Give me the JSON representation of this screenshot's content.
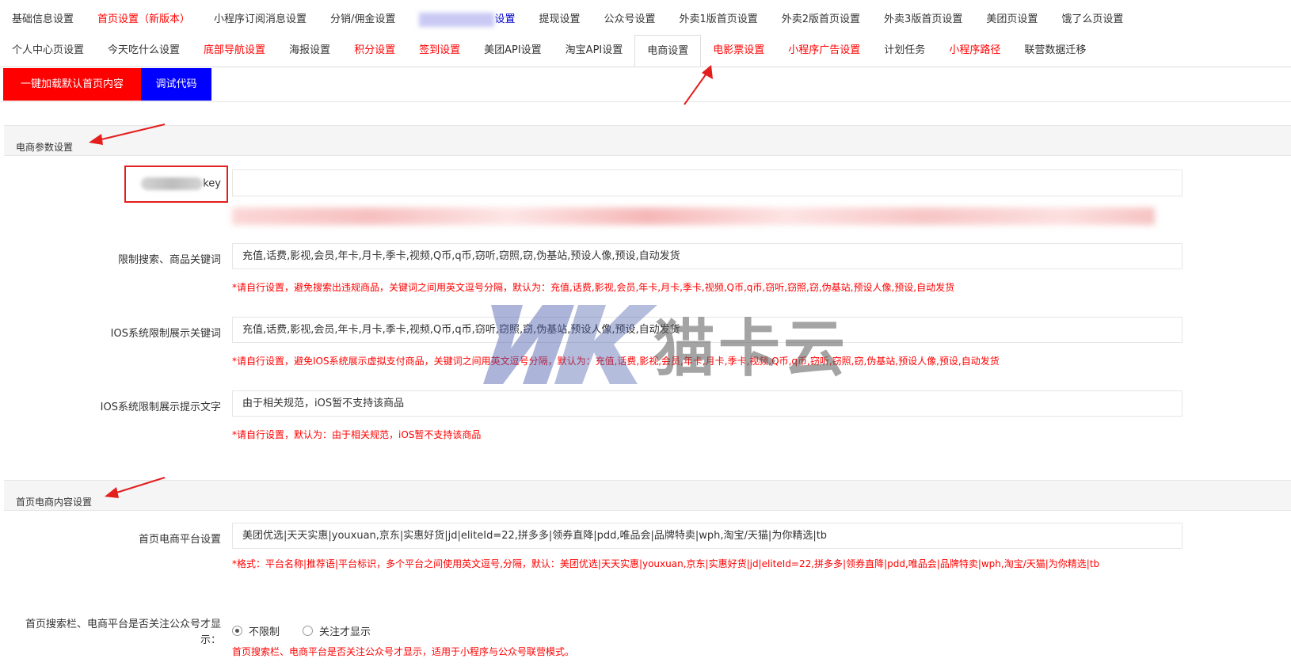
{
  "tabs_row1": [
    {
      "label": "基础信息设置",
      "red": false
    },
    {
      "label": "首页设置（新版本）",
      "red": true
    },
    {
      "label": "小程序订阅消息设置",
      "red": false
    },
    {
      "label": "分销/佣金设置",
      "red": false
    },
    {
      "label": "设置",
      "red": false,
      "blurred_prefix": true,
      "blue": true
    },
    {
      "label": "提现设置",
      "red": false
    },
    {
      "label": "公众号设置",
      "red": false
    },
    {
      "label": "外卖1版首页设置",
      "red": false
    },
    {
      "label": "外卖2版首页设置",
      "red": false
    },
    {
      "label": "外卖3版首页设置",
      "red": false
    },
    {
      "label": "美团页设置",
      "red": false
    },
    {
      "label": "饿了么页设置",
      "red": false
    }
  ],
  "tabs_row2": [
    {
      "label": "个人中心页设置",
      "red": false
    },
    {
      "label": "今天吃什么设置",
      "red": false
    },
    {
      "label": "底部导航设置",
      "red": true
    },
    {
      "label": "海报设置",
      "red": false
    },
    {
      "label": "积分设置",
      "red": true
    },
    {
      "label": "签到设置",
      "red": true
    },
    {
      "label": "美团API设置",
      "red": false
    },
    {
      "label": "淘宝API设置",
      "red": false
    },
    {
      "label": "电商设置",
      "red": false,
      "active": true
    },
    {
      "label": "电影票设置",
      "red": true
    },
    {
      "label": "小程序广告设置",
      "red": true
    },
    {
      "label": "计划任务",
      "red": false
    },
    {
      "label": "小程序路径",
      "red": true
    },
    {
      "label": "联营数据迁移",
      "red": false
    }
  ],
  "buttons": {
    "load_default": "一键加载默认首页内容",
    "debug_code": "调试代码"
  },
  "section1": {
    "title": "电商参数设置",
    "key_label": "key",
    "key_value": "",
    "restrict_label": "限制搜索、商品关键词",
    "restrict_value": "充值,话费,影视,会员,年卡,月卡,季卡,视频,Q币,q币,窃听,窃照,窃,伪基站,预设人像,预设,自动发货",
    "restrict_hint": "*请自行设置，避免搜索出违规商品，关键词之间用英文逗号分隔，默认为：充值,话费,影视,会员,年卡,月卡,季卡,视频,Q币,q币,窃听,窃照,窃,伪基站,预设人像,预设,自动发货",
    "ios_label": "IOS系统限制展示关键词",
    "ios_value": "充值,话费,影视,会员,年卡,月卡,季卡,视频,Q币,q币,窃听,窃照,窃,伪基站,预设人像,预设,自动发货",
    "ios_hint": "*请自行设置，避免IOS系统展示虚拟支付商品，关键词之间用英文逗号分隔，默认为：充值,话费,影视,会员,年卡,月卡,季卡,视频,Q币,q币,窃听,窃照,窃,伪基站,预设人像,预设,自动发货",
    "ios_tip_label": "IOS系统限制展示提示文字",
    "ios_tip_value": "由于相关规范，iOS暂不支持该商品",
    "ios_tip_hint": "*请自行设置，默认为：由于相关规范，iOS暂不支持该商品"
  },
  "section2": {
    "title": "首页电商内容设置",
    "platform_label": "首页电商平台设置",
    "platform_value": "美团优选|天天实惠|youxuan,京东|实惠好货|jd|eliteId=22,拼多多|领券直降|pdd,唯品会|品牌特卖|wph,淘宝/天猫|为你精选|tb",
    "platform_hint": "*格式：平台名称|推荐语|平台标识，多个平台之间使用英文逗号,分隔，默认：美团优选|天天实惠|youxuan,京东|实惠好货|jd|eliteId=22,拼多多|领券直降|pdd,唯品会|品牌特卖|wph,淘宝/天猫|为你精选|tb",
    "follow_label_line1": "首页搜索栏、电商平台是否关注公众号才显",
    "follow_label_line2": "示：",
    "follow_options": [
      "不限制",
      "关注才显示"
    ],
    "follow_selected": "不限制",
    "follow_hint": "首页搜索栏、电商平台是否关注公众号才显示，适用于小程序与公众号联营模式。"
  },
  "watermark": {
    "text": "猫卡云"
  },
  "colors": {
    "accent_red": "#ff0000",
    "accent_blue": "#0000ff",
    "annotation_red": "#e41d1d"
  }
}
